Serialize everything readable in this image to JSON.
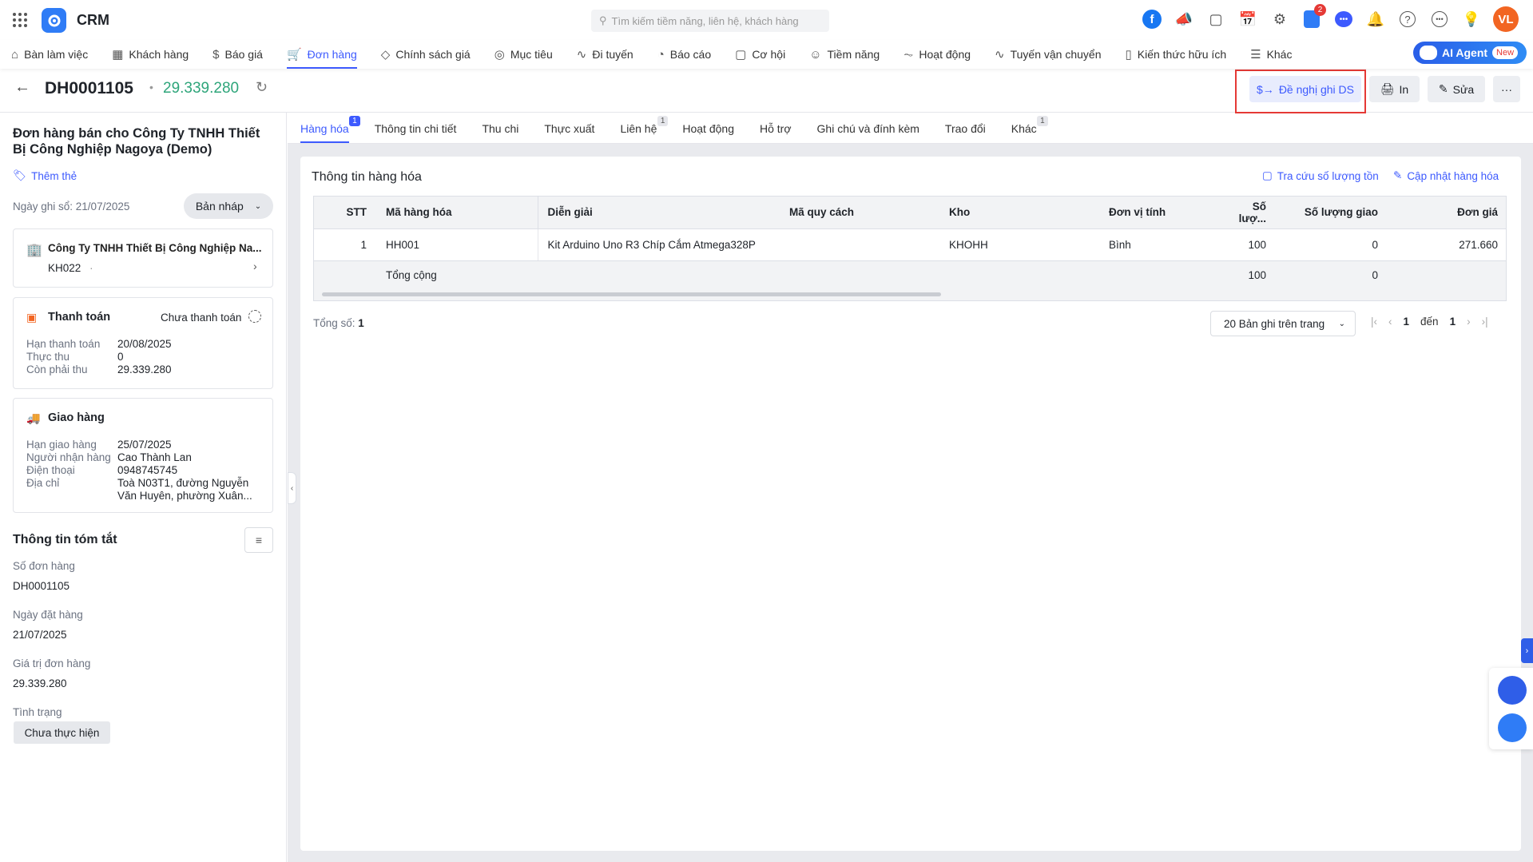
{
  "app": {
    "name": "CRM",
    "search_placeholder": "Tìm kiếm tiềm năng, liên hệ, khách hàng",
    "cart_badge": "2",
    "avatar": "VL",
    "ai_agent": "AI Agent",
    "ai_new": "New"
  },
  "nav": [
    {
      "label": "Bàn làm việc",
      "icon": "home"
    },
    {
      "label": "Khách hàng",
      "icon": "building"
    },
    {
      "label": "Báo giá",
      "icon": "dollar-doc"
    },
    {
      "label": "Đơn hàng",
      "icon": "cart"
    },
    {
      "label": "Chính sách giá",
      "icon": "tag"
    },
    {
      "label": "Mục tiêu",
      "icon": "target"
    },
    {
      "label": "Đi tuyến",
      "icon": "route"
    },
    {
      "label": "Báo cáo",
      "icon": "pie"
    },
    {
      "label": "Cơ hội",
      "icon": "bag"
    },
    {
      "label": "Tiềm năng",
      "icon": "user-circle"
    },
    {
      "label": "Hoạt động",
      "icon": "pulse"
    },
    {
      "label": "Tuyến vận chuyển",
      "icon": "route"
    },
    {
      "label": "Kiến thức hữu ích",
      "icon": "book"
    },
    {
      "label": "Khác",
      "icon": "menu"
    }
  ],
  "header": {
    "code": "DH0001105",
    "amount": "29.339.280",
    "actions": {
      "propose": "Đề nghị ghi DS",
      "print": "In",
      "edit": "Sửa",
      "more": "···"
    }
  },
  "left": {
    "title": "Đơn hàng bán cho Công Ty TNHH Thiết Bị Công Nghiệp Nagoya (Demo)",
    "add_tag": "Thêm thẻ",
    "record_date": "Ngày ghi sổ: 21/07/2025",
    "status_select": "Bản nháp",
    "customer": {
      "name": "Công Ty TNHH Thiết Bị Công Nghiệp Na...",
      "code": "KH022",
      "sep": "·"
    },
    "payment": {
      "title": "Thanh toán",
      "status": "Chưa thanh toán",
      "rows": [
        {
          "k": "Hạn thanh toán",
          "v": "20/08/2025"
        },
        {
          "k": "Thực thu",
          "v": "0"
        },
        {
          "k": "Còn phải thu",
          "v": "29.339.280"
        }
      ]
    },
    "delivery": {
      "title": "Giao hàng",
      "rows": [
        {
          "k": "Hạn giao hàng",
          "v": "25/07/2025"
        },
        {
          "k": "Người nhận hàng",
          "v": "Cao Thành Lan"
        },
        {
          "k": "Điện thoại",
          "v": "0948745745"
        },
        {
          "k": "Địa chỉ",
          "v": "Toà N03T1, đường Nguyễn Văn Huyên, phường Xuân..."
        }
      ]
    },
    "summary": {
      "title": "Thông tin tóm tắt",
      "fields": [
        {
          "k": "Số đơn hàng",
          "v": "DH0001105"
        },
        {
          "k": "Ngày đặt hàng",
          "v": "21/07/2025"
        },
        {
          "k": "Giá trị đơn hàng",
          "v": "29.339.280"
        }
      ],
      "status_label": "Tình trạng",
      "status_value": "Chưa thực hiện"
    }
  },
  "tabs": [
    {
      "label": "Hàng hóa",
      "badge": "1"
    },
    {
      "label": "Thông tin chi tiết"
    },
    {
      "label": "Thu chi"
    },
    {
      "label": "Thực xuất"
    },
    {
      "label": "Liên hệ",
      "badge": "1"
    },
    {
      "label": "Hoạt động"
    },
    {
      "label": "Hỗ trợ"
    },
    {
      "label": "Ghi chú và đính kèm"
    },
    {
      "label": "Trao đổi"
    },
    {
      "label": "Khác",
      "badge": "1"
    }
  ],
  "goods": {
    "title": "Thông tin hàng hóa",
    "lookup": "Tra cứu số lượng tồn",
    "update": "Cập nhật hàng hóa",
    "columns": [
      "STT",
      "Mã hàng hóa",
      "Diễn giải",
      "Mã quy cách",
      "Kho",
      "Đơn vị tính",
      "Số lượ...",
      "Số lượng giao",
      "Đơn giá"
    ],
    "rows": [
      {
        "stt": "1",
        "code": "HH001",
        "desc": "Kit Arduino Uno R3 Chíp Cắm Atmega328P",
        "spec": "",
        "warehouse": "KHOHH",
        "unit": "Bình",
        "qty": "100",
        "delivered": "0",
        "price": "271.660"
      }
    ],
    "total": {
      "label": "Tổng cộng",
      "qty": "100",
      "delivered": "0"
    },
    "count_label": "Tổng số:",
    "count": "1",
    "page_size": "20 Bản ghi trên trang",
    "page_from": "1",
    "page_to_label": "đến",
    "page_to": "1"
  }
}
